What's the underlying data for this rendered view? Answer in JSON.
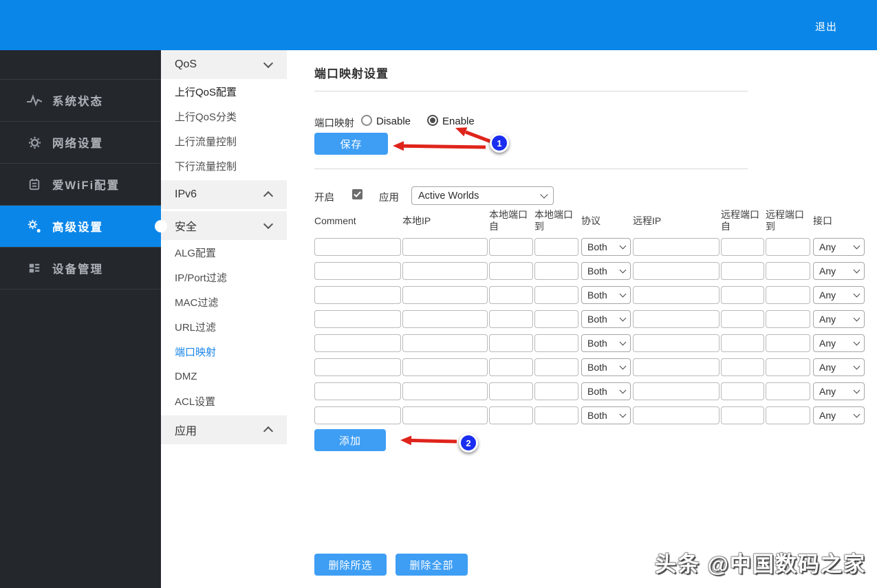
{
  "topbar": {
    "logout_label": "退出"
  },
  "sidebar": {
    "items": [
      {
        "label": "系统状态",
        "icon": "pulse-icon"
      },
      {
        "label": "网络设置",
        "icon": "gear-icon"
      },
      {
        "label": "爱WiFi配置",
        "icon": "wifi-config-icon"
      },
      {
        "label": "高级设置",
        "icon": "gears-icon"
      },
      {
        "label": "设备管理",
        "icon": "device-manage-icon"
      }
    ],
    "active_item": "高级设置"
  },
  "submenu": {
    "entries": [
      {
        "label": "QoS",
        "type": "header",
        "chevron": "down"
      },
      {
        "label": "上行QoS配置",
        "type": "item"
      },
      {
        "label": "上行QoS分类",
        "type": "item"
      },
      {
        "label": "上行流量控制",
        "type": "item"
      },
      {
        "label": "下行流量控制",
        "type": "item"
      },
      {
        "label": "IPv6",
        "type": "header",
        "chevron": "up"
      },
      {
        "label": "安全",
        "type": "header",
        "chevron": "down"
      },
      {
        "label": "ALG配置",
        "type": "item"
      },
      {
        "label": "IP/Port过滤",
        "type": "item"
      },
      {
        "label": "MAC过滤",
        "type": "item"
      },
      {
        "label": "URL过滤",
        "type": "item"
      },
      {
        "label": "端口映射",
        "type": "item",
        "active": true
      },
      {
        "label": "DMZ",
        "type": "item"
      },
      {
        "label": "ACL设置",
        "type": "item"
      },
      {
        "label": "应用",
        "type": "header",
        "chevron": "up"
      }
    ],
    "active_item": "端口映射"
  },
  "content": {
    "title": "端口映射设置",
    "port_mapping_label": "端口映射",
    "radio_disable_label": "Disable",
    "radio_enable_label": "Enable",
    "selected_radio": "Enable",
    "save_button": "保存",
    "enable_row": {
      "enable_label": "开启",
      "enable_checked": true,
      "app_label": "应用",
      "app_select_value": "Active Worlds"
    },
    "table": {
      "headers": [
        "Comment",
        "本地IP",
        "本地端口自",
        "本地端口到",
        "协议",
        "远程IP",
        "远程端口自",
        "远程端口到",
        "接口"
      ],
      "row_count": 8,
      "protocol_value": "Both",
      "interface_value": "Any"
    },
    "add_button": "添加",
    "delete_selected_button": "删除所选",
    "delete_all_button": "删除全部",
    "annotations": [
      {
        "badge": "1"
      },
      {
        "badge": "2"
      }
    ]
  },
  "watermark": "头条 @中国数码之家",
  "colors": {
    "topbar_blue": "#0a86e9",
    "button_blue": "#3e9ef4",
    "active_link_blue": "#1a86e8",
    "arrow_red": "#df241b",
    "badge_blue": "#1b2df0",
    "sidebar_dark": "#24272c"
  }
}
